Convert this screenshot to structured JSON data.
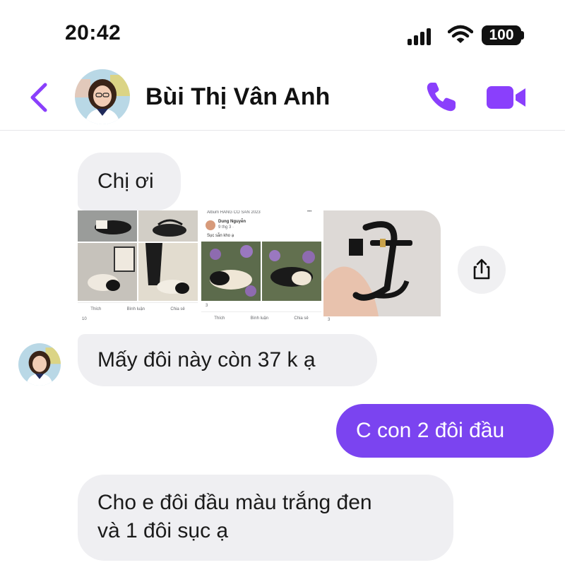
{
  "status_bar": {
    "time": "20:42",
    "battery": "100"
  },
  "header": {
    "contact_name": "Bùi Thị Vân Anh"
  },
  "messages": [
    {
      "direction": "incoming",
      "text": "Chị ơi"
    },
    {
      "direction": "incoming",
      "text": "Mấy đôi này còn 37 k ạ"
    },
    {
      "direction": "outgoing",
      "text": "C con 2 đôi đầu"
    },
    {
      "direction": "incoming",
      "lines": [
        "Cho e đôi đầu màu trắng đen",
        "và 1 đôi sục ạ"
      ]
    }
  ],
  "photos": {
    "card1": {
      "like": "Thích",
      "comment": "Bình luận",
      "share": "Chia sẻ",
      "reactions": "10"
    },
    "card2": {
      "album": "Album HÀNG CÓ SẴN 2023",
      "author": "Dung Nguyễn",
      "date": "9 thg 3 · ",
      "caption": "Sục sẵn kho ạ",
      "reactions": "3",
      "like": "Thích",
      "comment": "Bình luận",
      "share": "Chia sẻ"
    },
    "card3": {
      "reactions": "3"
    }
  },
  "colors": {
    "accent": "#7b44f0",
    "incoming_bubble": "#efeff2",
    "icon_purple": "#8a3ffc"
  },
  "icons": [
    "back-chevron",
    "phone",
    "video-camera",
    "share-upload",
    "signal",
    "wifi",
    "battery"
  ]
}
